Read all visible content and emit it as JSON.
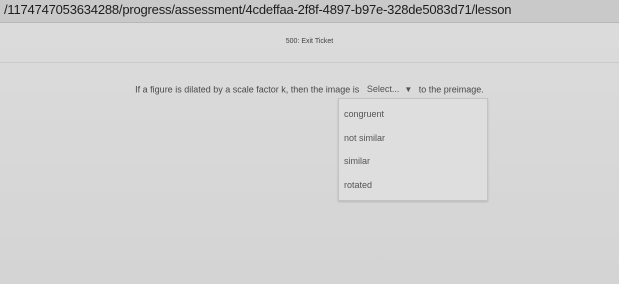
{
  "browser": {
    "url": "/1174747053634288/progress/assessment/4cdeffaa-2f8f-4897-b97e-328de5083d71/lesson"
  },
  "page": {
    "title": "500: Exit Ticket"
  },
  "question": {
    "prefix": "If a figure is dilated by a scale factor k, then the image is",
    "select_value": "Select...",
    "suffix": "to the preimage."
  },
  "dropdown": {
    "options": [
      "congruent",
      "not similar",
      "similar",
      "rotated"
    ]
  },
  "icons": {
    "dropdown": "chevron-down-icon"
  }
}
